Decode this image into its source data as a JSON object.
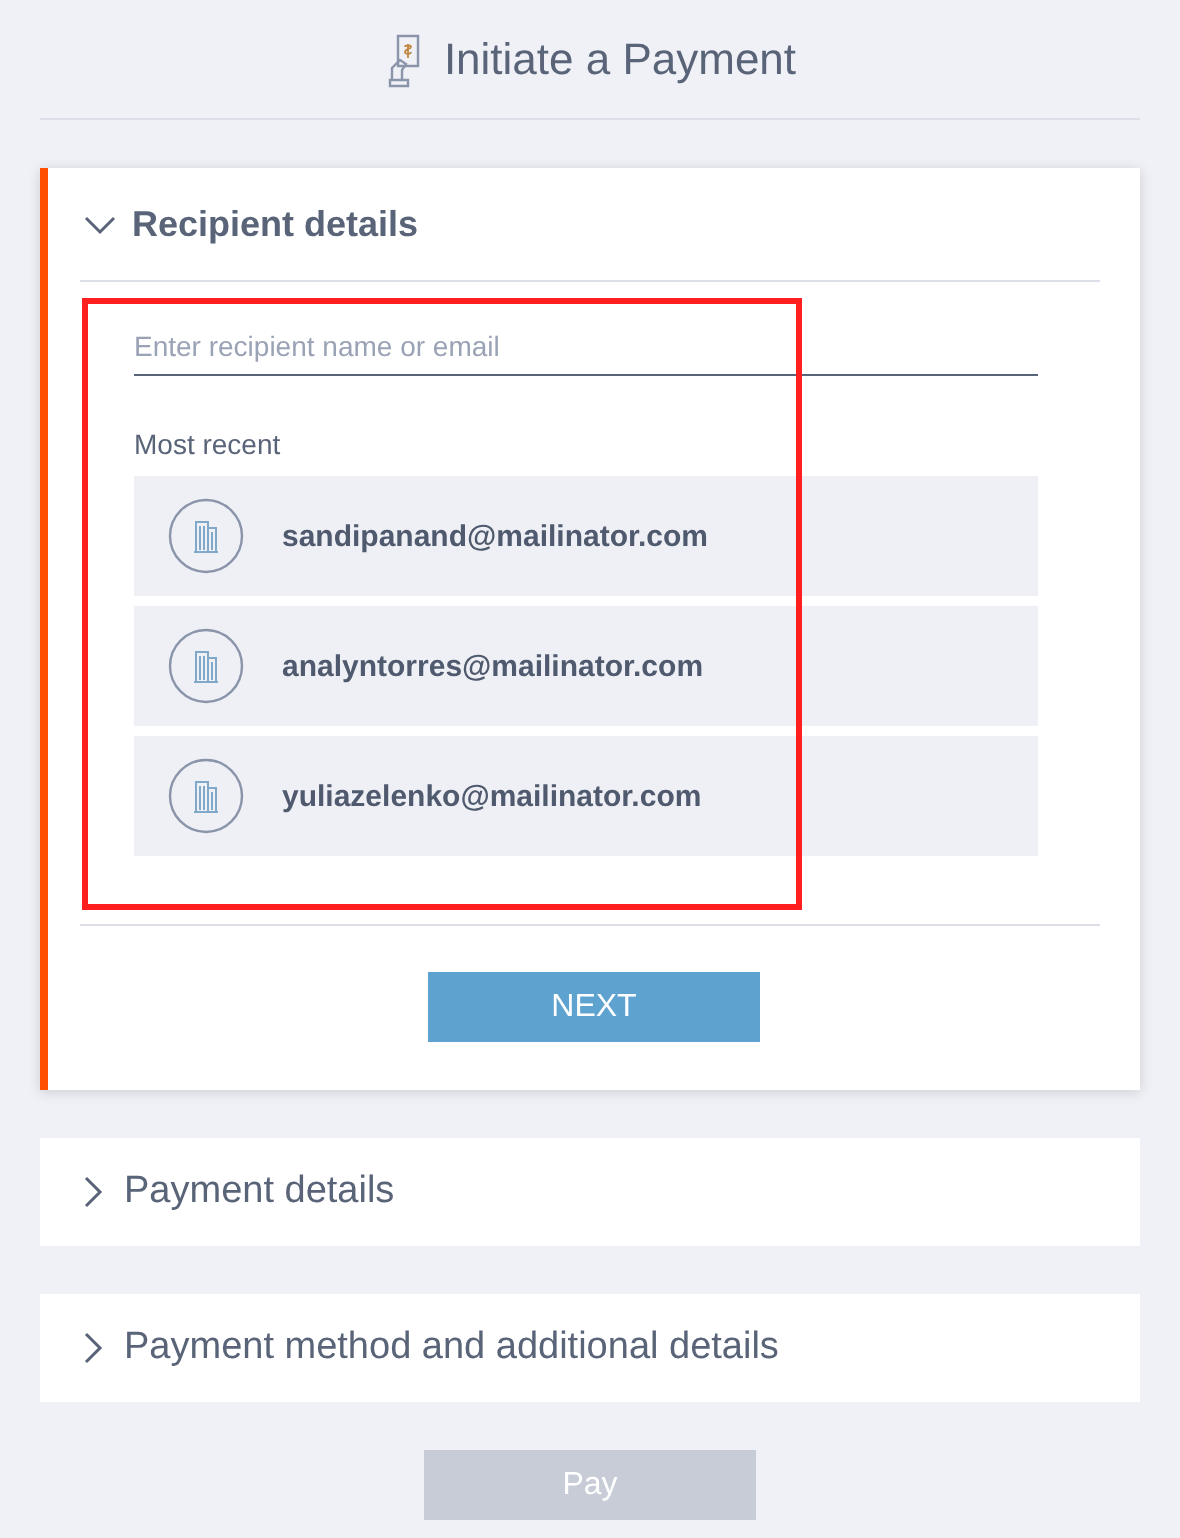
{
  "header": {
    "title": "Initiate a Payment"
  },
  "sections": [
    {
      "title": "Recipient details",
      "expanded": true,
      "active": true,
      "search": {
        "placeholder": "Enter recipient name or email"
      },
      "recent_label": "Most recent",
      "recipients": [
        {
          "email": "sandipanand@mailinator.com"
        },
        {
          "email": "analyntorres@mailinator.com"
        },
        {
          "email": "yuliazelenko@mailinator.com"
        }
      ],
      "button": {
        "label": "NEXT",
        "disabled": false
      }
    },
    {
      "title": "Payment details",
      "expanded": false,
      "active": false
    },
    {
      "title": "Payment method and additional details",
      "expanded": false,
      "active": false
    }
  ],
  "pay_button": {
    "label": "Pay",
    "disabled": true
  }
}
